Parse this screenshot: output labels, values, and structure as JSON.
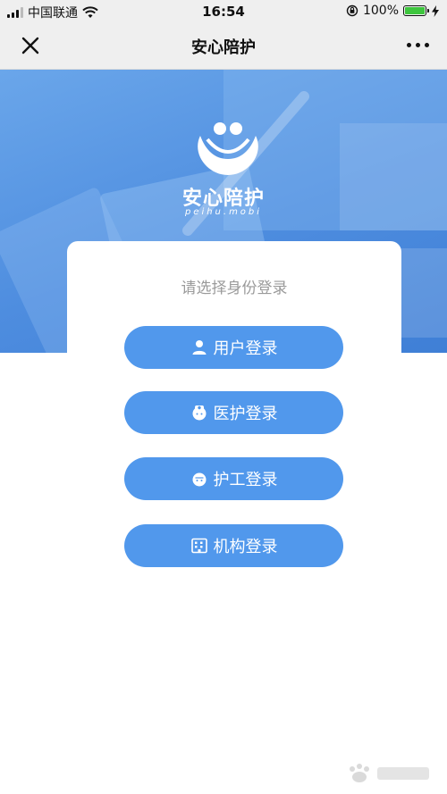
{
  "status_bar": {
    "carrier": "中国联通",
    "time": "16:54",
    "battery": "100%"
  },
  "nav": {
    "title": "安心陪护",
    "close_icon": "close-icon",
    "more_icon": "more-icon"
  },
  "hero": {
    "brand_name": "安心陪护",
    "brand_domain": "peihu.mobi"
  },
  "login": {
    "title": "请选择身份登录",
    "buttons": [
      {
        "label": "用户登录",
        "icon": "user-icon"
      },
      {
        "label": "医护登录",
        "icon": "medic-icon"
      },
      {
        "label": "护工登录",
        "icon": "nurse-icon"
      },
      {
        "label": "机构登录",
        "icon": "building-icon"
      }
    ]
  },
  "colors": {
    "accent": "#5198EC",
    "hero": "#4E8DDF",
    "battery": "#3EC63E"
  }
}
